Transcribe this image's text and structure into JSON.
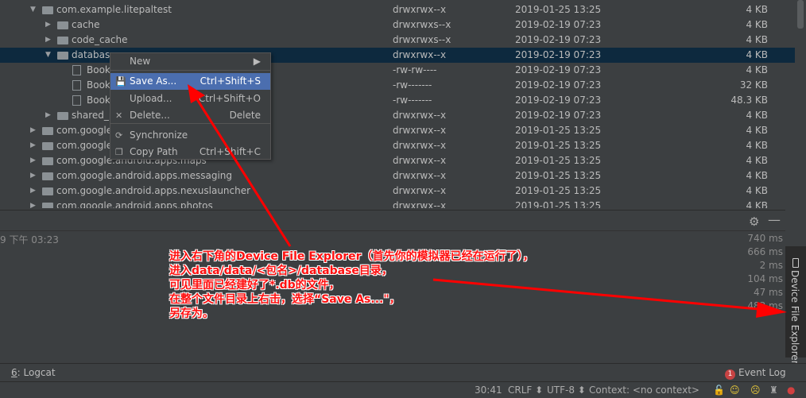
{
  "tree": {
    "rows": [
      {
        "name": "com.example.litepaltest",
        "perm": "drwxrwx--x",
        "date": "2019-01-25 13:25",
        "size": "4 KB",
        "level": 1,
        "expanded": true,
        "type": "folder"
      },
      {
        "name": "cache",
        "perm": "drwxrwxs--x",
        "date": "2019-02-19 07:23",
        "size": "4 KB",
        "level": 2,
        "expanded": false,
        "type": "folder"
      },
      {
        "name": "code_cache",
        "perm": "drwxrwxs--x",
        "date": "2019-02-19 07:23",
        "size": "4 KB",
        "level": 2,
        "expanded": false,
        "type": "folder"
      },
      {
        "name": "databases",
        "perm": "drwxrwx--x",
        "date": "2019-02-19 07:23",
        "size": "4 KB",
        "level": 2,
        "expanded": true,
        "type": "folder",
        "selected": true
      },
      {
        "name": "Book",
        "perm": "-rw-rw----",
        "date": "2019-02-19 07:23",
        "size": "4 KB",
        "level": 3,
        "type": "sql"
      },
      {
        "name": "Book",
        "perm": "-rw-------",
        "date": "2019-02-19 07:23",
        "size": "32 KB",
        "level": 3,
        "type": "file"
      },
      {
        "name": "Book",
        "perm": "-rw-------",
        "date": "2019-02-19 07:23",
        "size": "48.3 KB",
        "level": 3,
        "type": "file"
      },
      {
        "name": "shared_p",
        "perm": "drwxrwx--x",
        "date": "2019-02-19 07:23",
        "size": "4 KB",
        "level": 2,
        "expanded": false,
        "type": "folder"
      },
      {
        "name": "com.google",
        "perm": "drwxrwx--x",
        "date": "2019-01-25 13:25",
        "size": "4 KB",
        "level": 1,
        "expanded": false,
        "type": "folder"
      },
      {
        "name": "com.google",
        "perm": "drwxrwx--x",
        "date": "2019-01-25 13:25",
        "size": "4 KB",
        "level": 1,
        "expanded": false,
        "type": "folder"
      },
      {
        "name": "com.google.android.apps.maps",
        "perm": "drwxrwx--x",
        "date": "2019-01-25 13:25",
        "size": "4 KB",
        "level": 1,
        "expanded": false,
        "type": "folder"
      },
      {
        "name": "com.google.android.apps.messaging",
        "perm": "drwxrwx--x",
        "date": "2019-01-25 13:25",
        "size": "4 KB",
        "level": 1,
        "expanded": false,
        "type": "folder"
      },
      {
        "name": "com.google.android.apps.nexuslauncher",
        "perm": "drwxrwx--x",
        "date": "2019-01-25 13:25",
        "size": "4 KB",
        "level": 1,
        "expanded": false,
        "type": "folder"
      },
      {
        "name": "com.google.android.apps.photos",
        "perm": "drwxrwx--x",
        "date": "2019-01-25 13:25",
        "size": "4 KB",
        "level": 1,
        "expanded": false,
        "type": "folder"
      }
    ]
  },
  "context_menu": {
    "items": [
      {
        "label": "New",
        "shortcut": "▶",
        "icon": ""
      },
      {
        "label": "Save As...",
        "shortcut": "Ctrl+Shift+S",
        "icon": "save-icon"
      },
      {
        "label": "Upload...",
        "shortcut": "Ctrl+Shift+O",
        "icon": ""
      },
      {
        "label": "Delete...",
        "shortcut": "Delete",
        "icon": "delete-x-icon"
      },
      {
        "label": "Synchronize",
        "shortcut": "",
        "icon": "sync-icon"
      },
      {
        "label": "Copy Path",
        "shortcut": "Ctrl+Shift+C",
        "icon": "copy-icon"
      }
    ]
  },
  "log": {
    "time": "9 下午 03:23",
    "durations": [
      "740 ms",
      "666 ms",
      "2 ms",
      "104 ms",
      "47 ms",
      "483 ms"
    ]
  },
  "side_tool": {
    "label": "Device File Explorer"
  },
  "toolbar": {
    "logcat_num": "6",
    "logcat_label": ": Logcat",
    "event_count": "1",
    "event_log": "Event Log"
  },
  "status": {
    "position": "30:41",
    "line_sep": "CRLF ⬍",
    "encoding": "UTF-8 ⬍",
    "context": "Context: <no context>"
  },
  "annotation": {
    "lines": [
      "进入右下角的Device File Explorer（首先你的模拟器已经在运行了），",
      "进入data/data/<包名>/database目录，",
      "可见里面已经建好了*.db的文件，",
      "在整个文件目录上右击，选择“Save As...\"，",
      "另存为。"
    ],
    "color": "#ff1010"
  },
  "colors": {
    "selection": "#0d293e",
    "menu_highlight": "#4b6eaf",
    "background": "#3c3f41"
  }
}
